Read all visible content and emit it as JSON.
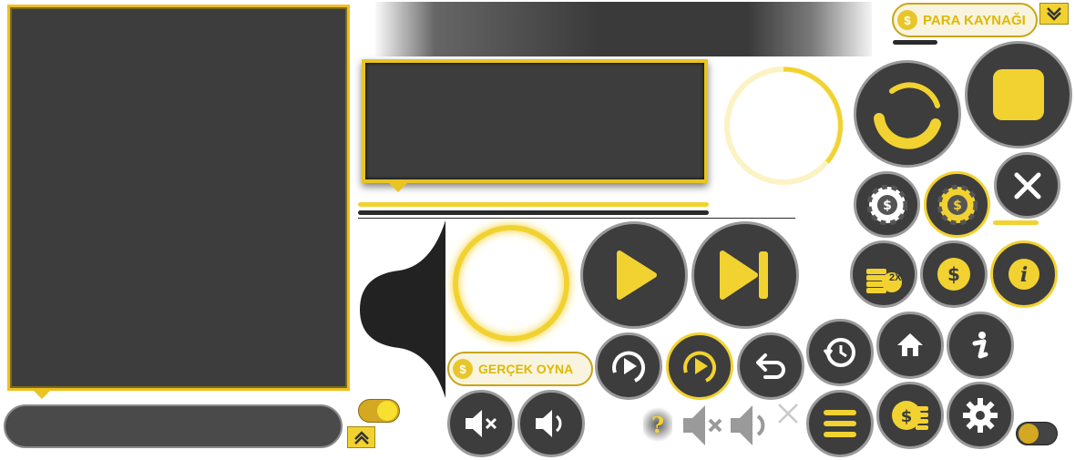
{
  "buttons": {
    "para_kaynagi": "PARA KAYNAĞI",
    "gercek_oyna": "GERÇEK OYNA",
    "double_badge": "2X",
    "help_mark": "?"
  },
  "icons": {
    "play": "play-icon",
    "skip": "skip-next-icon",
    "stop": "stop-icon",
    "close": "close-icon",
    "info": "info-icon",
    "home": "home-icon",
    "settings": "gear-icon",
    "menu": "menu-icon",
    "undo": "undo-icon",
    "history": "history-icon",
    "mute": "mute-icon",
    "sound": "sound-icon"
  },
  "colors": {
    "accent": "#f2d230",
    "dark": "#3d3d3d",
    "border": "#9a9a9a"
  }
}
